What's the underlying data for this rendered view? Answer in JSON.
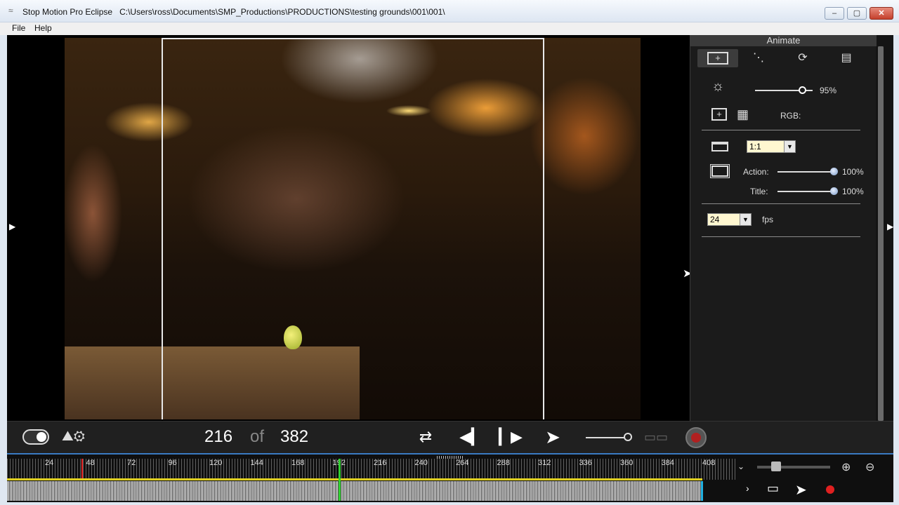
{
  "window": {
    "title": "Stop Motion Pro Eclipse",
    "path": "C:\\Users\\ross\\Documents\\SMP_Productions\\PRODUCTIONS\\testing grounds\\001\\001\\",
    "minimize_glyph": "–",
    "maximize_glyph": "▢",
    "close_glyph": "✕"
  },
  "menu": {
    "file": "File",
    "help": "Help"
  },
  "panel": {
    "header": "Animate",
    "brightness_value": "95%",
    "brightness_level": 0.95,
    "rgb_label": "RGB:",
    "aspect_value": "1:1",
    "action_label": "Action:",
    "action_value": "100%",
    "action_level": 1.0,
    "title_label": "Title:",
    "title_value": "100%",
    "title_level": 1.0,
    "fps_value": "24",
    "fps_label": "fps"
  },
  "controls": {
    "frame_current": "216",
    "frame_of": "of",
    "frame_total": "382"
  },
  "timeline": {
    "ticks": [
      "24",
      "48",
      "72",
      "96",
      "120",
      "144",
      "168",
      "192",
      "216",
      "240",
      "264",
      "288",
      "312",
      "336",
      "360",
      "384",
      "408"
    ],
    "current_frame": 216
  },
  "icons": {
    "app": "film-icon",
    "cursor": "pointer-icon",
    "brightness": "sun-icon",
    "grid": "grid-icon"
  },
  "colors": {
    "accent": "#3a7ac2",
    "playhead": "#30d030",
    "record": "#b02020",
    "waveform_line": "#e0d020"
  }
}
